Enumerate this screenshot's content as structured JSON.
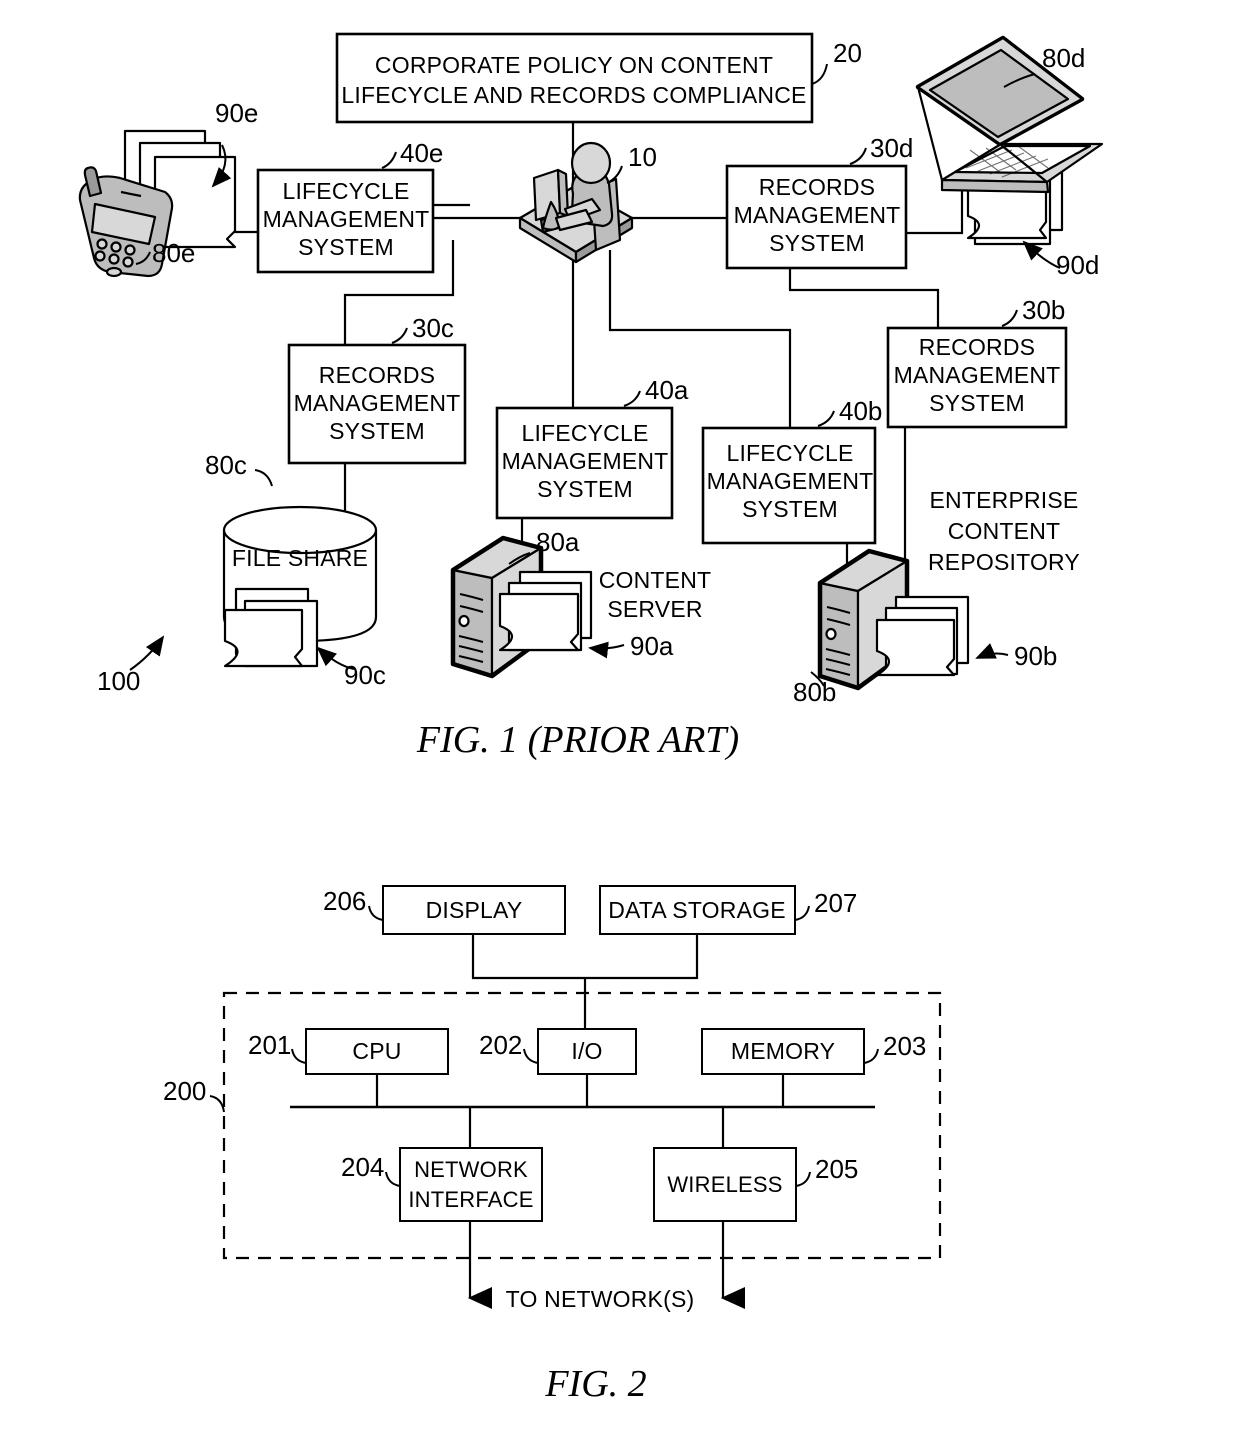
{
  "document": {
    "title": "Patent drawing sheet: FIG. 1 (PRIOR ART) and FIG. 2"
  },
  "figures": [
    {
      "id": "fig1",
      "caption": "FIG. 1 (PRIOR ART)",
      "system_reference": "100",
      "nodes": {
        "policy": {
          "ref": "20",
          "lines": [
            "CORPORATE POLICY ON CONTENT",
            "LIFECYCLE AND RECORDS COMPLIANCE"
          ]
        },
        "user": {
          "ref": "10",
          "label": "user-at-workstation"
        },
        "lms_e": {
          "ref": "40e",
          "lines": [
            "LIFECYCLE",
            "MANAGEMENT",
            "SYSTEM"
          ]
        },
        "rms_d": {
          "ref": "30d",
          "lines": [
            "RECORDS",
            "MANAGEMENT",
            "SYSTEM"
          ]
        },
        "rms_c": {
          "ref": "30c",
          "lines": [
            "RECORDS",
            "MANAGEMENT",
            "SYSTEM"
          ]
        },
        "rms_b": {
          "ref": "30b",
          "lines": [
            "RECORDS",
            "MANAGEMENT",
            "SYSTEM"
          ]
        },
        "lms_a": {
          "ref": "40a",
          "lines": [
            "LIFECYCLE",
            "MANAGEMENT",
            "SYSTEM"
          ]
        },
        "lms_b": {
          "ref": "40b",
          "lines": [
            "LIFECYCLE",
            "MANAGEMENT",
            "SYSTEM"
          ]
        },
        "phone": {
          "ref": "80e",
          "docs_ref": "90e"
        },
        "laptop": {
          "ref": "80d",
          "docs_ref": "90d"
        },
        "file_share": {
          "ref": "80c",
          "docs_ref": "90c",
          "lines": [
            "FILE SHARE"
          ]
        },
        "content_server": {
          "ref": "80a",
          "docs_ref": "90a",
          "lines": [
            "CONTENT",
            "SERVER"
          ]
        },
        "enterprise_repo": {
          "ref": "80b",
          "docs_ref": "90b",
          "lines": [
            "ENTERPRISE",
            "CONTENT",
            "REPOSITORY"
          ]
        }
      }
    },
    {
      "id": "fig2",
      "caption": "FIG. 2",
      "system_reference": "200",
      "nodes": {
        "display": {
          "ref": "206",
          "lines": [
            "DISPLAY"
          ]
        },
        "data_storage": {
          "ref": "207",
          "lines": [
            "DATA STORAGE"
          ]
        },
        "cpu": {
          "ref": "201",
          "lines": [
            "CPU"
          ]
        },
        "io": {
          "ref": "202",
          "lines": [
            "I/O"
          ]
        },
        "memory": {
          "ref": "203",
          "lines": [
            "MEMORY"
          ]
        },
        "network_interface": {
          "ref": "204",
          "lines": [
            "NETWORK",
            "INTERFACE"
          ]
        },
        "wireless": {
          "ref": "205",
          "lines": [
            "WIRELESS"
          ]
        }
      },
      "annotations": {
        "to_networks": "TO NETWORK(S)"
      }
    }
  ],
  "colors": {
    "ink": "#000000",
    "paper": "#ffffff",
    "shade_light": "#d8d8d8",
    "shade_mid": "#bdbdbd",
    "shade_dark": "#9a9a9a"
  }
}
